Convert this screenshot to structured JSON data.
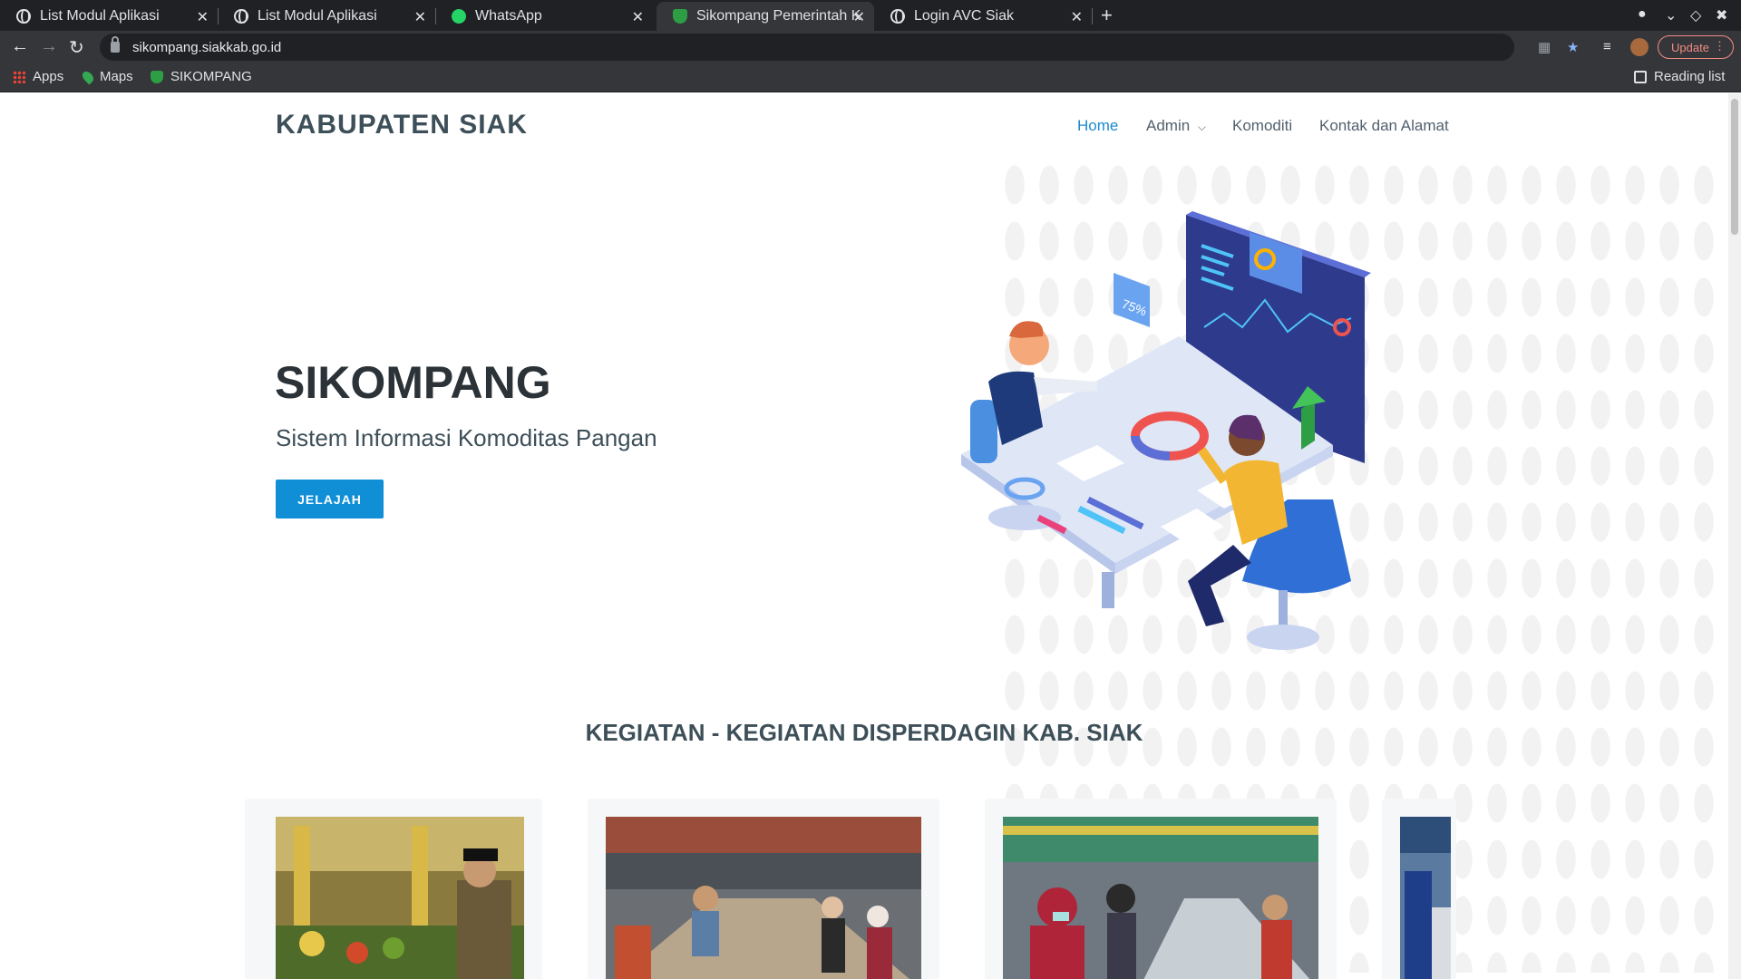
{
  "browser": {
    "tabs": [
      {
        "title": "List Modul Aplikasi",
        "favicon": "globe-icon"
      },
      {
        "title": "List Modul Aplikasi",
        "favicon": "globe-icon"
      },
      {
        "title": "WhatsApp",
        "favicon": "whatsapp-icon"
      },
      {
        "title": "Sikompang Pemerintah K",
        "favicon": "shield-icon",
        "active": true
      },
      {
        "title": "Login AVC Siak",
        "favicon": "globe-icon"
      }
    ],
    "url": "sikompang.siakkab.go.id",
    "update_label": "Update",
    "bookmarks": [
      {
        "label": "Apps"
      },
      {
        "label": "Maps"
      },
      {
        "label": "SIKOMPANG"
      }
    ],
    "reading_list": "Reading list"
  },
  "site": {
    "brand": "KABUPATEN SIAK",
    "nav": [
      {
        "label": "Home",
        "active": true
      },
      {
        "label": "Admin",
        "dropdown": true
      },
      {
        "label": "Komoditi"
      },
      {
        "label": "Kontak dan Alamat"
      }
    ],
    "hero": {
      "title": "SIKOMPANG",
      "subtitle": "Sistem Informasi Komoditas Pangan",
      "button": "JELAJAH",
      "badge": "75%"
    },
    "section_title": "KEGIATAN - KEGIATAN DISPERDAGIN KAB. SIAK"
  },
  "colors": {
    "accent": "#108fd7",
    "nav_active": "#1b8ad1",
    "heading": "#2b3338"
  }
}
